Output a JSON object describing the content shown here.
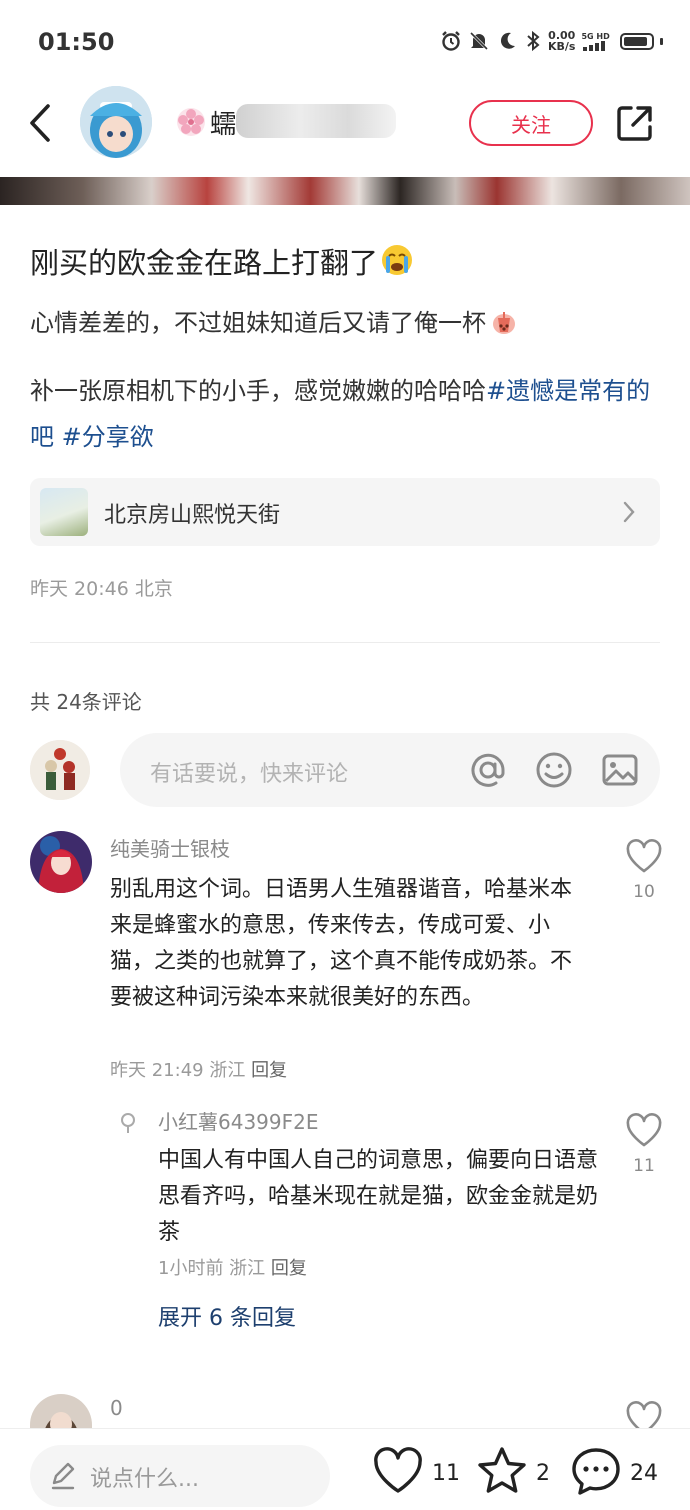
{
  "status_bar": {
    "time": "01:50",
    "net_speed_value": "0.00",
    "net_speed_unit": "KB/s",
    "network_label": "5G HD"
  },
  "header": {
    "author_name_visible": "蠕",
    "follow_label": "关注"
  },
  "post": {
    "title": "刚买的欧金金在路上打翻了",
    "line1": "心情差差的，不过姐妹知道后又请了俺一杯",
    "line2_text": "补一张原相机下的小手，感觉嫩嫩的哈哈哈",
    "tag1_first": "#遗",
    "tag1_rest": "憾是常有的吧",
    "tag2": "#分享欲",
    "location": "北京房山熙悦天街",
    "meta": "昨天 20:46 北京"
  },
  "comments_section": {
    "count_label": "共 24条评论",
    "input_placeholder": "有话要说，快来评论",
    "comments": [
      {
        "name": "纯美骑士银枝",
        "text": "别乱用这个词。日语男人生殖器谐音，哈基米本来是蜂蜜水的意思，传来传去，传成可爱、小猫，之类的也就算了，这个真不能传成奶茶。不要被这种词污染本来就很美好的东西。",
        "meta": "昨天 21:49 浙江",
        "reply_label": "回复",
        "likes": "10"
      },
      {
        "name": "小红薯64399F2E",
        "text": "中国人有中国人自己的词意思，偏要向日语意思看齐吗，哈基米现在就是猫，欧金金就是奶茶",
        "meta": "1小时前 浙江",
        "reply_label": "回复",
        "likes": "11"
      },
      {
        "name": "0",
        "text": "",
        "meta": "",
        "reply_label": "",
        "likes": ""
      }
    ],
    "expand_label": "展开 6 条回复"
  },
  "bottom_bar": {
    "input_placeholder": "说点什么...",
    "likes": "11",
    "stars": "2",
    "comments": "24"
  },
  "colors": {
    "accent": "#e8314d",
    "tag": "#1d4f8f",
    "expand": "#1d3f6e"
  },
  "icons": [
    "back-arrow-icon",
    "share-icon",
    "flower-icon",
    "crying-emoji-icon",
    "chevron-right-icon",
    "at-icon",
    "smile-icon",
    "image-icon",
    "heart-icon",
    "star-icon",
    "comment-bubble-icon",
    "pencil-icon"
  ]
}
